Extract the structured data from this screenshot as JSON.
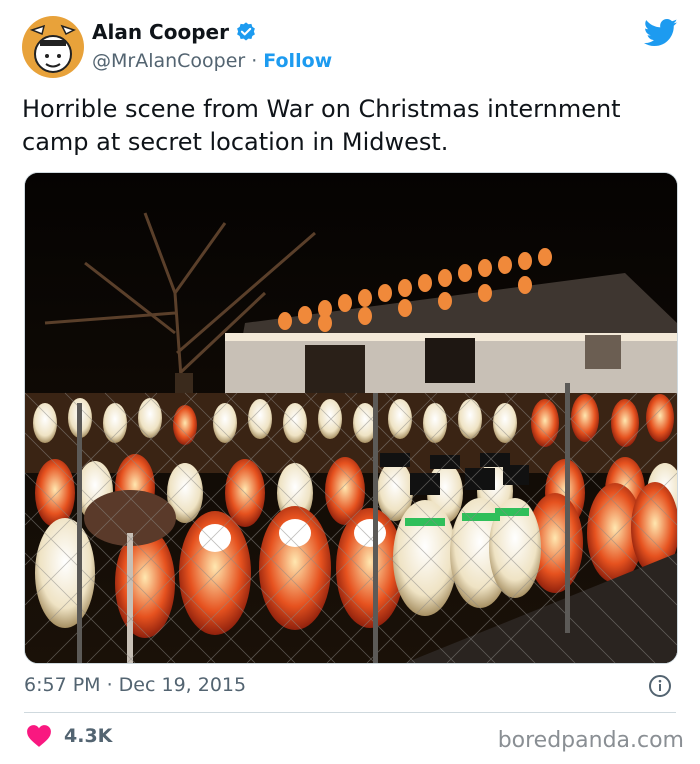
{
  "author": {
    "name": "Alan Cooper",
    "handle": "@MrAlanCooper",
    "separator": "·",
    "follow_label": "Follow"
  },
  "tweet": {
    "text": "Horrible scene from War on Christmas internment camp at secret location in Midwest.",
    "timestamp": "6:57 PM · Dec 19, 2015",
    "likes": "4.3K"
  },
  "watermark": "boredpanda.com",
  "colors": {
    "accent": "#1d9bf0",
    "heart": "#f91880",
    "text_secondary": "#536471"
  },
  "icons": {
    "verified": "verified-badge-icon",
    "platform": "twitter-bird-icon",
    "info": "info-icon",
    "like": "heart-icon"
  }
}
